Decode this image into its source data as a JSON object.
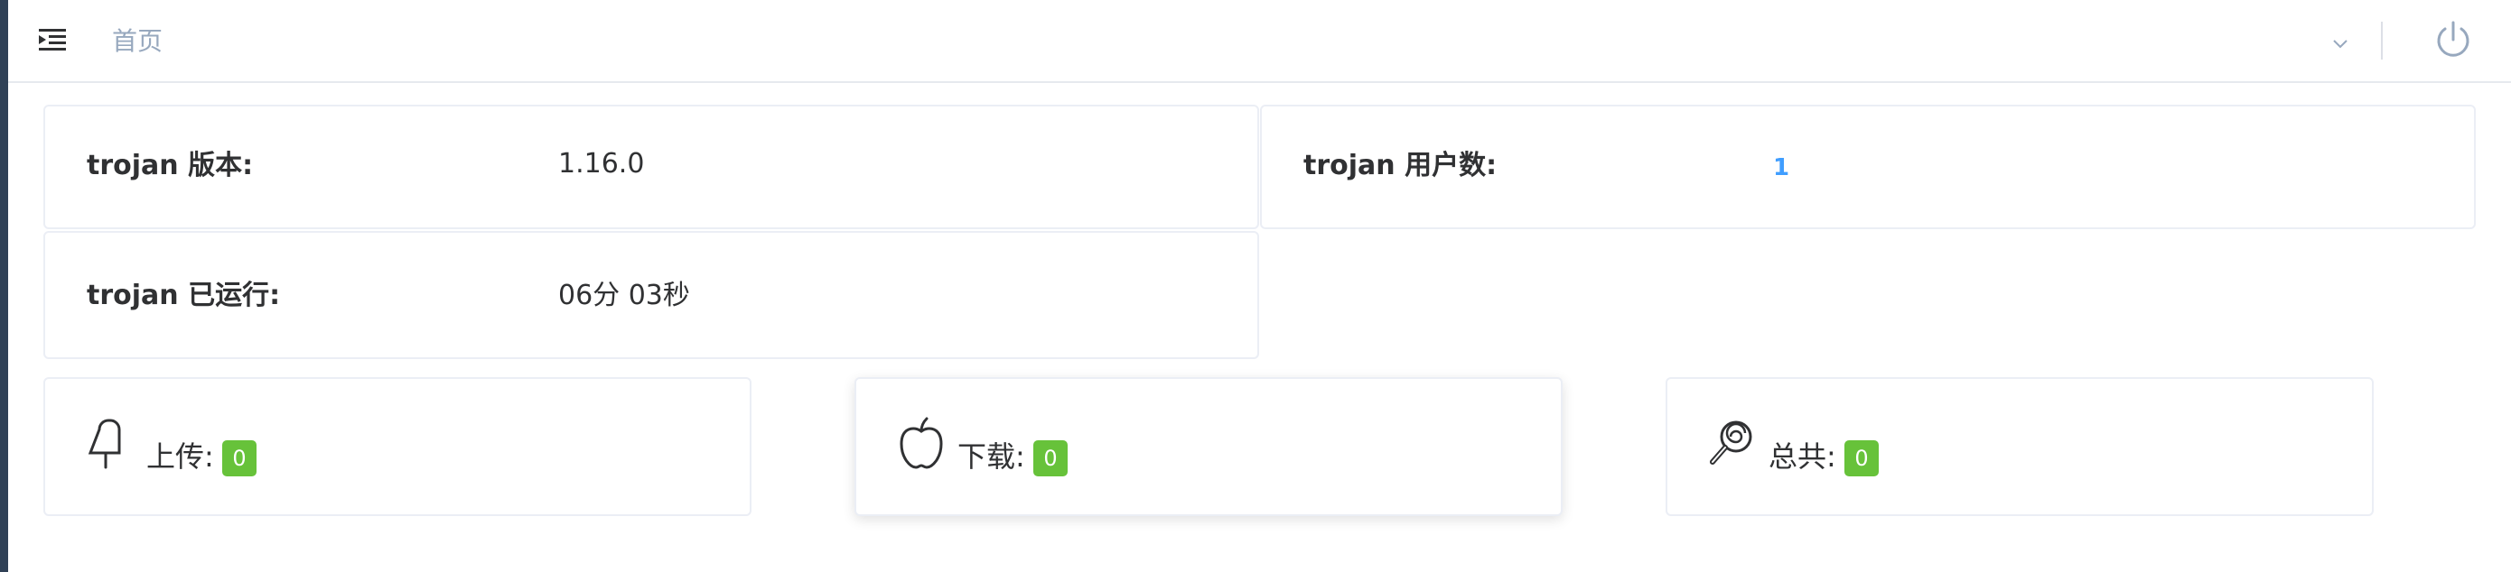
{
  "header": {
    "breadcrumb": "首页",
    "icons": {
      "menu": "menu-fold-icon",
      "dropdown": "chevron-down-icon",
      "logout": "power-icon"
    }
  },
  "info": {
    "version_label": "trojan 版本:",
    "version_value": "1.16.0",
    "users_label": "trojan 用户数:",
    "users_value": "1",
    "uptime_label": "trojan 已运行:",
    "uptime_value": "06分 03秒"
  },
  "traffic": {
    "upload_label": "上传:",
    "upload_value": "0",
    "upload_icon": "popsicle-icon",
    "download_label": "下载:",
    "download_value": "0",
    "download_icon": "apple-icon",
    "total_label": "总共:",
    "total_value": "0",
    "total_icon": "lollipop-icon"
  },
  "colors": {
    "badge": "#67c23a",
    "link": "#409eff",
    "breadcrumb": "#97a8be",
    "sidebar": "#304156"
  }
}
